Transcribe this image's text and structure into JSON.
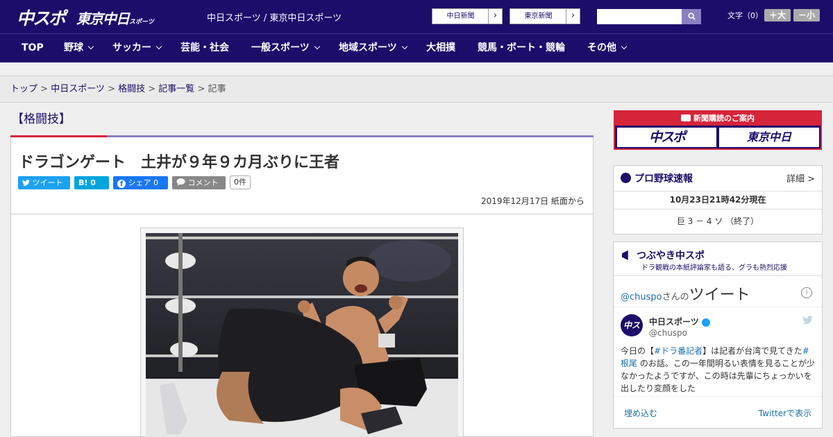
{
  "header": {
    "logo_main": "中スポ",
    "logo_tokyo": "東京中日",
    "logo_tokyo_small": "スポーツ",
    "site_title": "中日スポーツ / 東京中日スポーツ",
    "chunichi_btn": "中日新聞",
    "tokyo_btn": "東京新聞",
    "search_placeholder": "",
    "font_label": "文字（0）",
    "font_plus": "＋大",
    "font_minus": "－小"
  },
  "nav": {
    "items": [
      {
        "label": "TOP"
      },
      {
        "label": "野球"
      },
      {
        "label": "サッカー"
      },
      {
        "label": "芸能・社会"
      },
      {
        "label": "一般スポーツ"
      },
      {
        "label": "地域スポーツ"
      },
      {
        "label": "大相撲"
      },
      {
        "label": "競馬・ボート・競輪"
      },
      {
        "label": "その他"
      }
    ]
  },
  "breadcrumb": {
    "top": "トップ",
    "chunichi": "中日スポーツ",
    "category": "格闘技",
    "list": "記事一覧",
    "current": "記事",
    "sep": " > "
  },
  "article": {
    "category": "【格闘技】",
    "headline": "ドラゴンゲート　土井が９年９カ月ぶりに王者",
    "tweet_label": "ツイート",
    "hatena_label": "B! 0",
    "fb_label": "シェア 0",
    "comment_label": "コメント",
    "comment_count": "0件",
    "dateline": "2019年12月17日 紙面から"
  },
  "sidebar": {
    "ad_title": "新聞購読のご案内",
    "ad_logo1": "中スポ",
    "ad_logo2": "東京中日",
    "baseball_title": "プロ野球速報",
    "baseball_detail": "詳細 >",
    "baseball_time": "10月23日21時42分現在",
    "baseball_score": "巨 3 － 4 ソ （終了）",
    "tsubuyaki_title": "つぶやき中スポ",
    "tsubuyaki_sub": "ドラ観戦の本紙評論家も語る、グラも熱烈応援",
    "tw_handle_prefix": "@chuspo",
    "tw_header_san": "さんの",
    "tw_header_big": "ツイート",
    "tw_avatar": "中スポ",
    "tw_name": "中日スポーツ",
    "tw_handle": "@chuspo",
    "tw_text_1": "今日の【",
    "tw_text_tag1": "#ドラ番記者",
    "tw_text_2": "】は記者が台湾で見てきた",
    "tw_text_tag2": "#根尾",
    "tw_text_3": " のお話。この一年間明るい表情を見ることが少なかったようですが、この時は先輩にちょっかいを出したり変顔をした",
    "tw_embed": "埋め込む",
    "tw_view": "Twitterで表示"
  }
}
